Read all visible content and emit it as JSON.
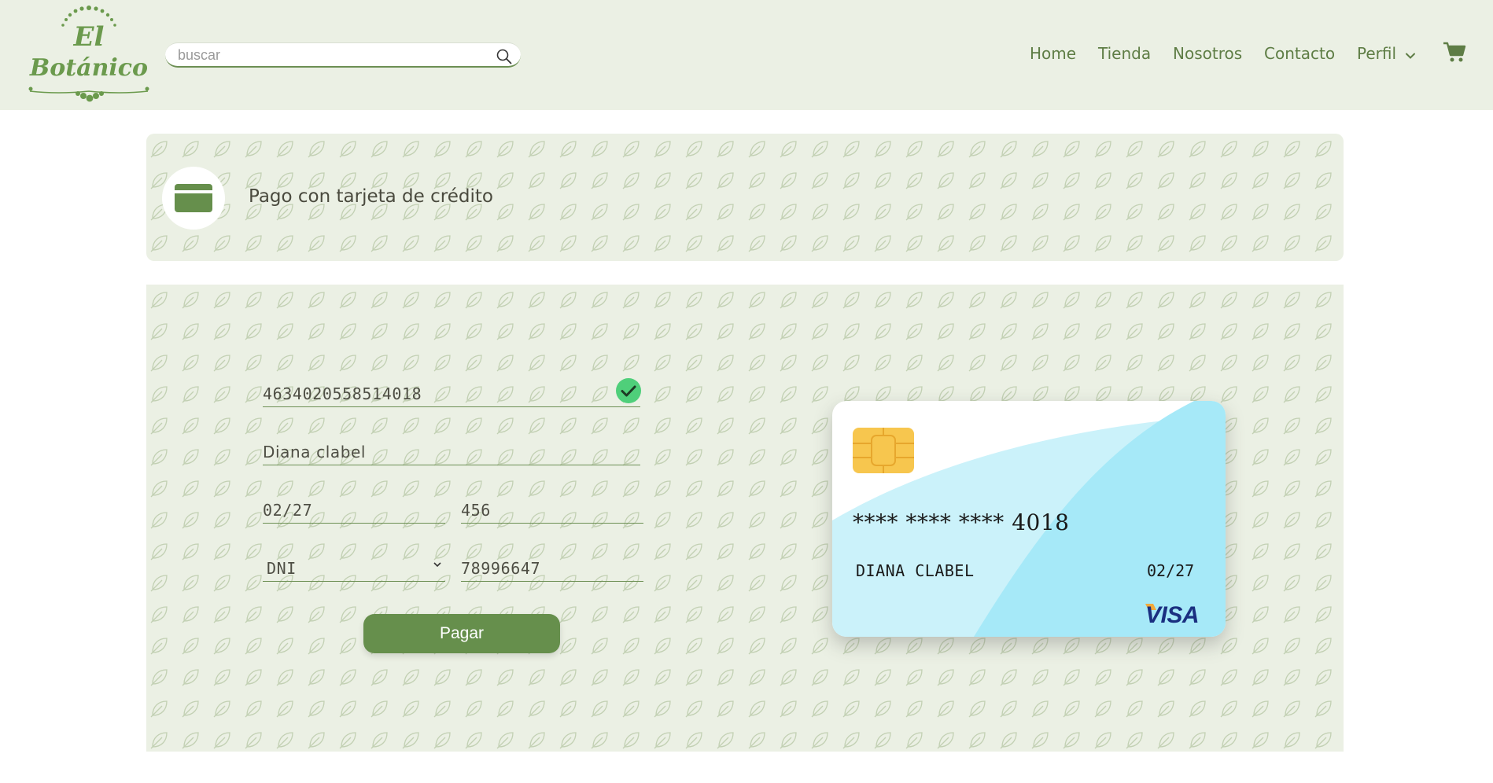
{
  "header": {
    "logo_text_line1": "El",
    "logo_text_line2": "Botánico",
    "search_placeholder": "buscar",
    "nav": [
      {
        "label": "Home"
      },
      {
        "label": "Tienda"
      },
      {
        "label": "Nosotros"
      },
      {
        "label": "Contacto"
      },
      {
        "label": "Perfil"
      }
    ]
  },
  "page": {
    "title": "Pago con tarjeta de crédito"
  },
  "form": {
    "card_number": "4634020558514018",
    "card_holder": "Diana clabel",
    "expiry": "02/27",
    "cvv": "456",
    "doc_type_selected": "DNI",
    "doc_number": "78996647",
    "pay_label": "Pagar"
  },
  "card_preview": {
    "masked_number": "**** **** **** 4018",
    "holder": "DIANA CLABEL",
    "expiry": "02/27",
    "brand": "VISA"
  },
  "colors": {
    "brand_green": "#668f4c",
    "header_bg": "#ebf0e4",
    "card_cyan": "#a8e9f7",
    "success_green": "#4fcf7a"
  }
}
